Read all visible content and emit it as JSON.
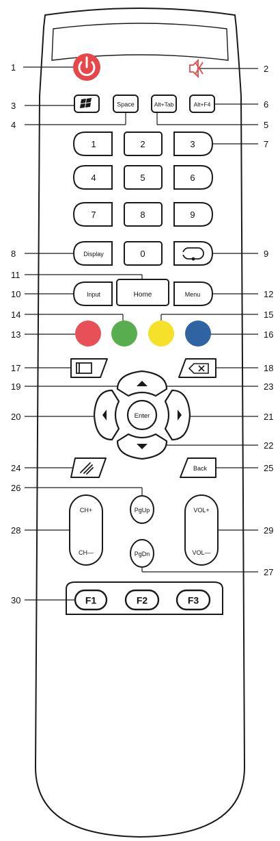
{
  "buttons": {
    "num1": "1",
    "num2": "2",
    "num3": "3",
    "num4": "4",
    "num5": "5",
    "num6": "6",
    "num7": "7",
    "num8": "8",
    "num9": "9",
    "num0": "0",
    "space": "Space",
    "alt_tab": "Alt+Tab",
    "alt_f4": "Alt+F4",
    "display": "Display",
    "input": "Input",
    "home": "Home",
    "menu": "Menu",
    "enter": "Enter",
    "back": "Back",
    "pgup": "PgUp",
    "pgdn": "PgDn",
    "ch_plus": "CH+",
    "ch_minus": "CH—",
    "vol_plus": "VOL+",
    "vol_minus": "VOL—",
    "f1": "F1",
    "f2": "F2",
    "f3": "F3"
  },
  "callouts": {
    "c1": "1",
    "c2": "2",
    "c3": "3",
    "c4": "4",
    "c5": "5",
    "c6": "6",
    "c7": "7",
    "c8": "8",
    "c9": "9",
    "c10": "10",
    "c11": "11",
    "c12": "12",
    "c13": "13",
    "c14": "14",
    "c15": "15",
    "c16": "16",
    "c17": "17",
    "c18": "18",
    "c19": "19",
    "c20": "20",
    "c21": "21",
    "c22": "22",
    "c23": "23",
    "c24": "24",
    "c25": "25",
    "c26": "26",
    "c27": "27",
    "c28": "28",
    "c29": "29",
    "c30": "30"
  },
  "colors": {
    "power": "#e8474a",
    "mute": "#e8474a",
    "red": "#e85058",
    "green": "#58ad4e",
    "yellow": "#f5e02a",
    "blue": "#2f63a2",
    "outline": "#1a1a1a"
  },
  "icons": {
    "power": "power-icon",
    "mute": "mute-icon",
    "windows": "windows-icon",
    "source_loop": "loop-icon",
    "pc_window": "window-icon",
    "backspace": "backspace-icon",
    "pen": "pen-icon",
    "up": "arrow-up-icon",
    "down": "arrow-down-icon",
    "left": "arrow-left-icon",
    "right": "arrow-right-icon"
  }
}
